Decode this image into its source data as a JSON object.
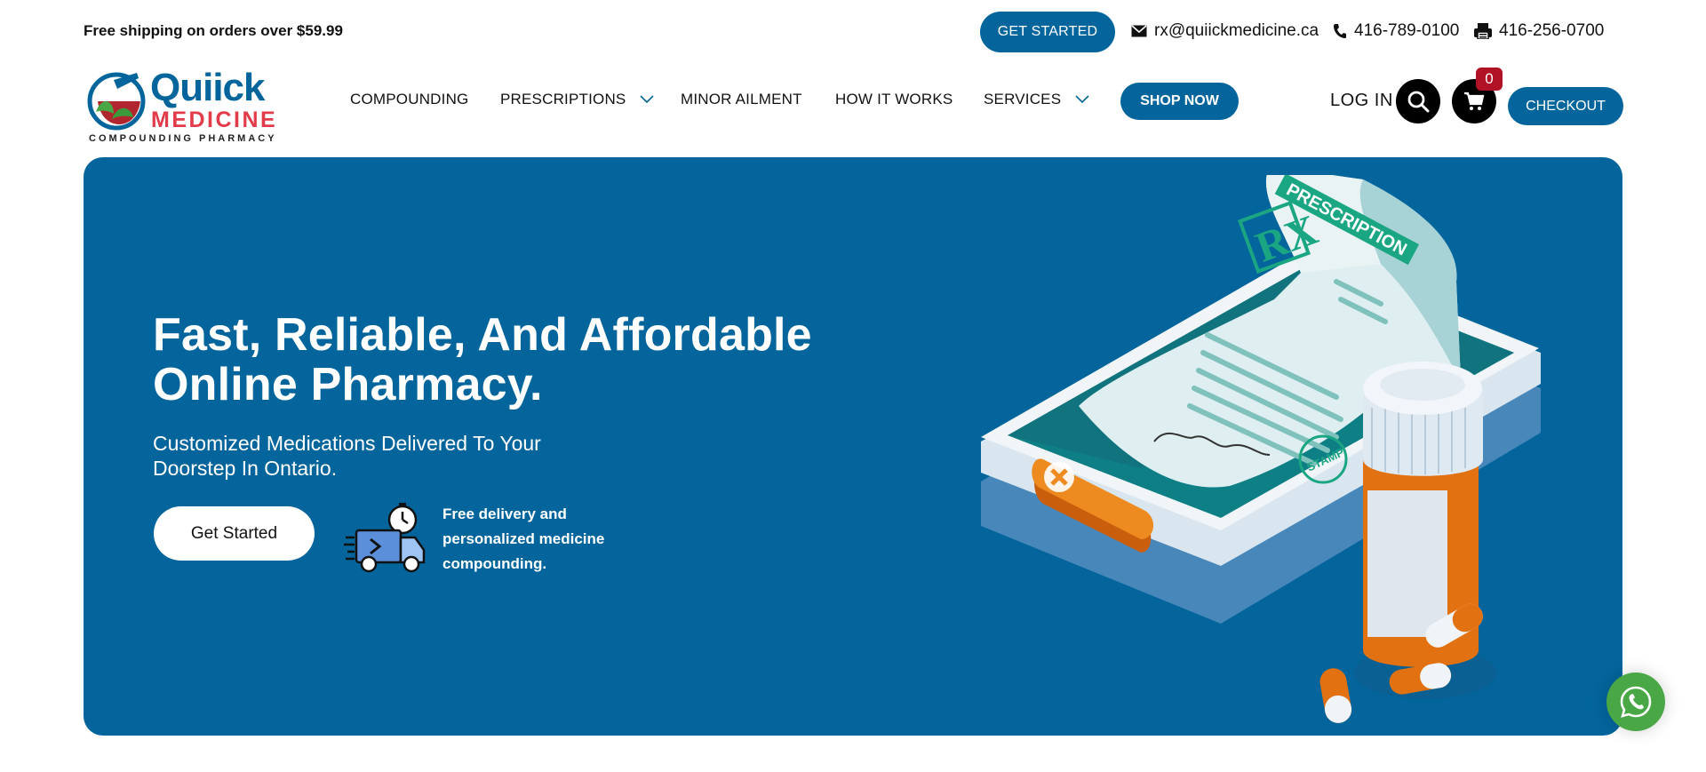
{
  "topbar": {
    "shipping_note": "Free shipping on orders over $59.99",
    "get_started_label": "GET STARTED",
    "email": "rx@quiickmedicine.ca",
    "phone": "416-789-0100",
    "fax": "416-256-0700"
  },
  "logo": {
    "word1": "Quiick",
    "word2": "MEDICINE",
    "tagline": "COMPOUNDING PHARMACY"
  },
  "nav": {
    "items": [
      {
        "label": "COMPOUNDING",
        "has_dropdown": false
      },
      {
        "label": "PRESCRIPTIONS",
        "has_dropdown": true
      },
      {
        "label": "MINOR AILMENT",
        "has_dropdown": false
      },
      {
        "label": "HOW IT WORKS",
        "has_dropdown": false
      },
      {
        "label": "SERVICES",
        "has_dropdown": true
      }
    ],
    "shop_now_label": "SHOP NOW",
    "login_label": "LOG IN",
    "cart_count": "0",
    "checkout_label": "CHECKOUT"
  },
  "hero": {
    "title": "Fast, Reliable, And Affordable Online Pharmacy.",
    "subtitle": "Customized Medications Delivered To Your Doorstep In Ontario.",
    "cta_label": "Get Started",
    "delivery_text": "Free delivery and personalized medicine compounding.",
    "art_text": {
      "prescription": "PRESCRIPTION",
      "rx": "RX",
      "stamp": "STAMP"
    }
  },
  "colors": {
    "brand_blue": "#03659c",
    "brand_red": "#e23b49",
    "badge_red": "#b11226",
    "whatsapp_green": "#4aa745",
    "accent_orange": "#e9801c",
    "accent_teal": "#1aa583"
  },
  "icons": [
    "envelope-icon",
    "phone-icon",
    "fax-icon",
    "chevron-down-icon",
    "search-icon",
    "cart-icon",
    "delivery-truck-icon",
    "whatsapp-icon"
  ]
}
